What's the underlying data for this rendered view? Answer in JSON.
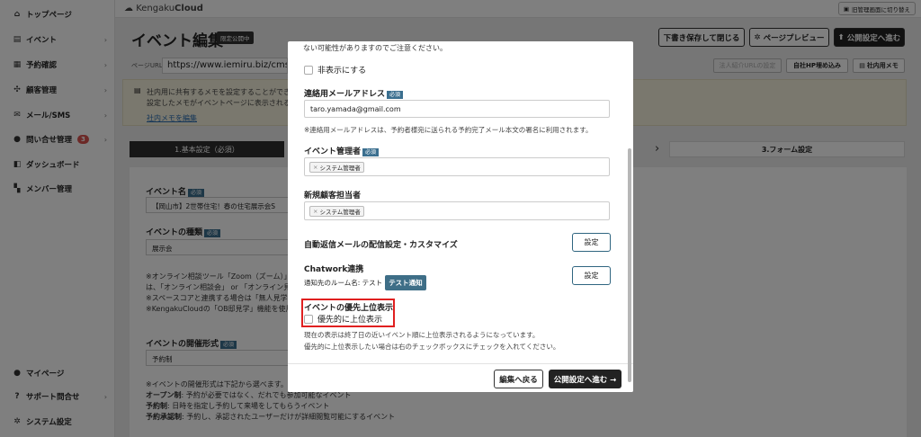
{
  "sidebar": {
    "items": [
      {
        "icon": "home-icon",
        "glyph": "⌂",
        "label": "トップページ",
        "chevron": ""
      },
      {
        "icon": "document-icon",
        "glyph": "▤",
        "label": "イベント",
        "chevron": "›"
      },
      {
        "icon": "calendar-icon",
        "glyph": "▦",
        "label": "予約確認",
        "chevron": "›"
      },
      {
        "icon": "users-icon",
        "glyph": "✣",
        "label": "顧客管理",
        "chevron": "›"
      },
      {
        "icon": "mail-icon",
        "glyph": "✉",
        "label": "メール/SMS",
        "chevron": "›"
      },
      {
        "icon": "chat-icon",
        "glyph": "●",
        "label": "問い合せ管理",
        "badge": "3",
        "chevron": "›"
      },
      {
        "icon": "dashboard-icon",
        "glyph": "◧",
        "label": "ダッシュボード",
        "chevron": ""
      },
      {
        "icon": "grid-icon",
        "glyph": "▚",
        "label": "メンバー管理",
        "chevron": ""
      }
    ],
    "bottom": [
      {
        "icon": "person-icon",
        "glyph": "●",
        "label": "マイページ",
        "chevron": ""
      },
      {
        "icon": "help-icon",
        "glyph": "?",
        "label": "サポート問合せ",
        "chevron": "›"
      },
      {
        "icon": "settings-icon",
        "glyph": "✲",
        "label": "システム設定",
        "chevron": ""
      }
    ]
  },
  "topbar": {
    "logo_prefix": "Kengaku",
    "logo_suffix": "Cloud",
    "admin_label": "旧管理画面に切り替え"
  },
  "header": {
    "title": "イベント編集",
    "limited_badge": "限定公開中",
    "save_draft": "下書き保存して閉じる",
    "preview": "ページプレビュー",
    "publish": "公開設定へ進む"
  },
  "url_row": {
    "label": "ページURL",
    "value": "https://www.iemiru.biz/cms/yo",
    "corp_url_btn": "法人紹介URLの設定",
    "embed_btn": "自社HP埋め込み",
    "memo_btn": "社内用メモ"
  },
  "memo": {
    "line1": "社内用に共有するメモを設定することができま",
    "line2": "設定したメモがイベントページに表示されるこ",
    "link": "社内メモを編集"
  },
  "steps": {
    "step1": "1.基本設定（必須）",
    "step3": "3.フォーム設定"
  },
  "form": {
    "event_name_label": "イベント名",
    "required": "必須",
    "event_name_value": "【岡山市】2世帯住宅！春の住宅展示会S",
    "event_type_label": "イベントの種類",
    "event_type_value": "展示会",
    "note1": "※オンライン相談ツール「Zoom（ズーム）」",
    "note2": "は、「オンライン相談会」 or 「オンライン見学",
    "note3": "※スペースコアと連携する場合は「無人見学会",
    "note4": "※KengakuCloudの「OB邸見学」機能を使用",
    "format_label": "イベントの開催形式",
    "format_value": "予約制",
    "format_note": "※イベントの開催形式は下記から選べます。",
    "open_label": "オープン制",
    "open_text": ": 予約が必要ではなく、だれでも参加可能なイベント",
    "reserve_label": "予約制",
    "reserve_text": ": 日時を指定し予約して来場をしてもらうイベント",
    "approval_label": "予約承認制",
    "approval_text": ": 予約し、承認されたユーザーだけが詳細閲覧可能にするイベント"
  },
  "modal": {
    "top_note": "ない可能性がありますのでご注意ください。",
    "hide_label": "非表示にする",
    "contact_email_label": "連絡用メールアドレス",
    "required": "必須",
    "contact_email_value": "taro.yamada@gmail.com",
    "contact_email_note": "※連絡用メールアドレスは、予約者様宛に送られる予約完了メール本文の署名に利用されます。",
    "manager_label": "イベント管理者",
    "manager_tag": "システム管理者",
    "new_customer_label": "新規顧客担当者",
    "new_customer_tag": "システム管理者",
    "autoreply_label": "自動返信メールの配信設定・カスタマイズ",
    "settings_btn": "設定",
    "chatwork_label": "Chatwork連携",
    "room_label": "通知先のルーム名: テスト",
    "test_btn": "テスト通知",
    "priority_label": "イベントの優先上位表示",
    "priority_checkbox": "優先的に上位表示",
    "priority_note1": "現在の表示は終了日の近いイベント順に上位表示されるようになっています。",
    "priority_note2": "優先的に上位表示したい場合は右のチェックボックスにチェックを入れてください。",
    "back_btn": "編集へ戻る",
    "next_btn": "公開設定へ進む →"
  }
}
